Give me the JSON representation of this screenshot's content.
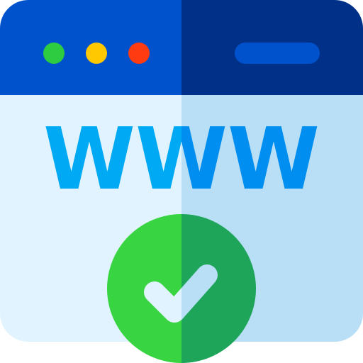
{
  "icon": {
    "name": "website-verified-icon",
    "window": {
      "titlebar_left_color": "#0052cc",
      "titlebar_right_color": "#003087",
      "body_left_color": "#e0f3ff",
      "body_right_color": "#b8dff5"
    },
    "dots": {
      "green": "#2ecc40",
      "yellow": "#ffc800",
      "red": "#ff3b12"
    },
    "address_bar_color": "#0052cc",
    "www_text": "WWW",
    "www_color_left": "#00a9f4",
    "www_color_right": "#008ff0",
    "badge": {
      "left_color": "#39d441",
      "right_color": "#1ea55a",
      "check_left_color": "#e0f3ff",
      "check_right_color": "#b8dff5"
    }
  }
}
